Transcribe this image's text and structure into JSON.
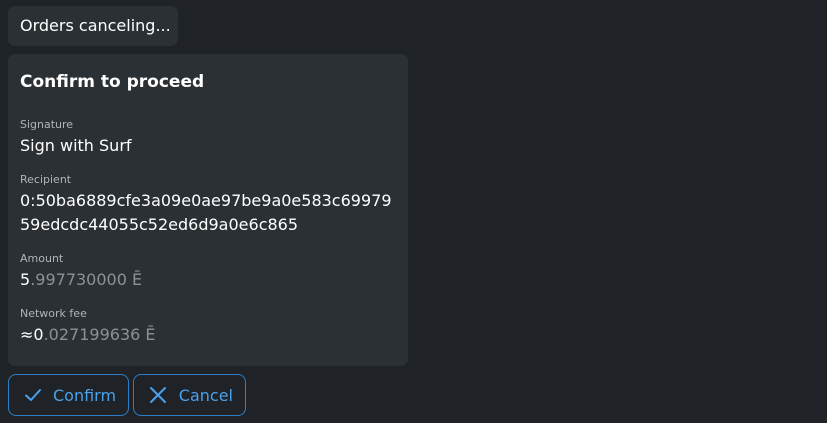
{
  "status": {
    "text": "Orders canceling..."
  },
  "confirm": {
    "title": "Confirm to proceed",
    "signature": {
      "label": "Signature",
      "value": "Sign with Surf"
    },
    "recipient": {
      "label": "Recipient",
      "line1": "0:50ba6889cfe3a09e0ae97be9a0e583c69979",
      "line2": "59edcdc44055c52ed6d9a0e6c865"
    },
    "amount": {
      "label": "Amount",
      "integer": "5",
      "fraction": ".997730000",
      "unit": " Ē"
    },
    "network_fee": {
      "label": "Network fee",
      "prefix": "≈",
      "integer": "0",
      "fraction": ".027199636",
      "unit": " Ē"
    }
  },
  "actions": {
    "confirm_label": "Confirm",
    "cancel_label": "Cancel"
  },
  "colors": {
    "background": "#1f2327",
    "card": "#2b3035",
    "accent": "#4ba0ea",
    "accent_border": "#2d7ec7",
    "muted_text": "#8b9196"
  },
  "icons": {
    "confirm": "check-icon",
    "cancel": "close-icon"
  }
}
